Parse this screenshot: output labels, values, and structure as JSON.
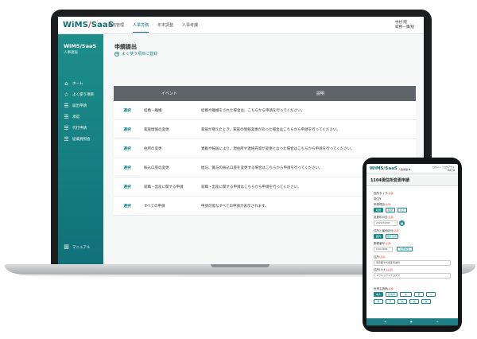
{
  "desktop": {
    "logo": {
      "main": "WiMS",
      "slash": "/",
      "suffix": "SaaS"
    },
    "nav": [
      "勤務管理",
      "人事労務",
      "年末調整",
      "人事考課"
    ],
    "nav_active_index": 1,
    "user": {
      "name": "中村 陽",
      "dept": "総務一課/総"
    },
    "sidebar": {
      "title": "WiMS/SaaS",
      "subtitle": "人事諸届",
      "items": [
        {
          "icon": "home-icon",
          "glyph": "⌂",
          "label": "ホーム"
        },
        {
          "icon": "star-icon",
          "glyph": "☆",
          "label": "よく使う項目"
        },
        {
          "icon": "list-icon",
          "glyph": "☰",
          "label": "届出申請"
        },
        {
          "icon": "list-icon",
          "glyph": "☰",
          "label": "承認"
        },
        {
          "icon": "list-icon",
          "glyph": "☰",
          "label": "代行申請"
        },
        {
          "icon": "list-icon",
          "glyph": "☰",
          "label": "従業員照会"
        }
      ],
      "manual": {
        "icon": "book-icon",
        "glyph": "▥",
        "label": "マニュアル"
      }
    },
    "page": {
      "title": "申請提出",
      "favorite_link": "よく使う項目に登録",
      "table": {
        "headers": [
          "イベント",
          "説明"
        ],
        "select_label": "選択",
        "rows": [
          {
            "event": "結婚・離婚",
            "description": "結婚や離婚をされた場合は、こちらから申請を行ってください。"
          },
          {
            "event": "家族情報の変更",
            "description": "家族が増えたとき、家族の情報変更があった場合はこちらから申請を行ってください。"
          },
          {
            "event": "住所の変更",
            "description": "異動や転居により、現住所や連絡先等が変更となった場合はこちらから申請を行ってください。"
          },
          {
            "event": "振込口座の変更",
            "description": "給与、賞与の振込口座を変更する場合はこちらから申請を行ってください。"
          },
          {
            "event": "就職・出産に関する申請",
            "description": "就職・出産に関する申請はこちらから申請を行ってください。"
          },
          {
            "event": "すべての申請",
            "description": "申請可能なすべての申請が表示されます。"
          }
        ]
      }
    }
  },
  "phone": {
    "logo": {
      "main": "WiMS",
      "slash": "/",
      "suffix": "SaaS"
    },
    "module": "人事諸届 ▼",
    "user": [
      "ログイン・ログアウト",
      "中村 陽"
    ],
    "title": "1104現住所変更申請",
    "required_mark": "(必須)",
    "fields": {
      "type_label": "住所タイプ",
      "type_value": "現住所",
      "reason_label": "申請理由",
      "reason_options": [
        "転居",
        "転勤",
        "訂正"
      ],
      "date_label": "変更年月日",
      "date_value": "2024/01/06",
      "zip_label": "住所と番地区分",
      "zip_options": [
        "国内",
        "国外住所"
      ],
      "postal_label": "郵便番号",
      "postal_value": "100-0006",
      "postal_button": "住所検索",
      "address_label": "住所",
      "address_value": "東京都千代田区有楽町",
      "address_kana_label": "住所(カナ)",
      "address_kana_value": "トウキョウトチヨダク",
      "family_label": "世帯主続柄",
      "family_options": [
        "本人",
        "配偶者",
        "夫",
        "妻",
        "父",
        "母",
        "兄",
        "弟",
        "姉",
        "妹"
      ]
    },
    "bottom_nav": [
      "◀",
      "●",
      "≡"
    ]
  },
  "colors": {
    "brand": "#0d6e74",
    "accent": "#1b8a88",
    "logo_slash": "#e2392a",
    "sidebar": "#1d8e8a",
    "table_header": "#5f6468"
  }
}
